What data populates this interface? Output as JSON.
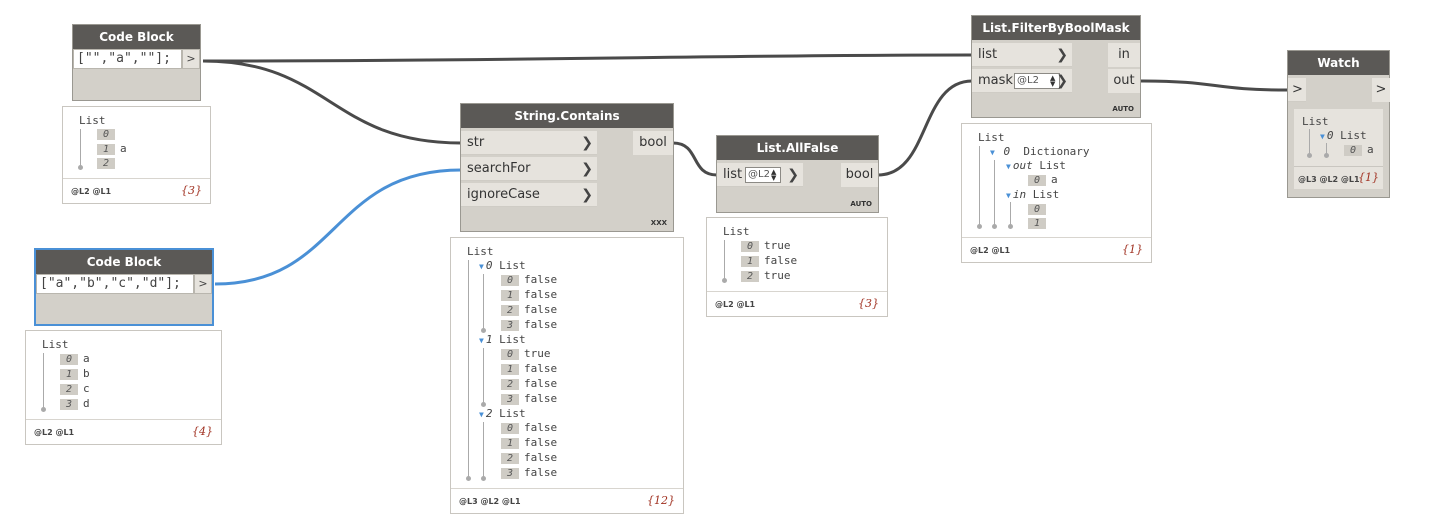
{
  "colors": {
    "node_header": "#5b5956",
    "node_body": "#d3d0c9",
    "wire": "#4a4a4a",
    "selected_wire": "#4a90d6",
    "count": "#a03020"
  },
  "code_block_1": {
    "title": "Code Block",
    "code": "[\"\",\"a\",\"\"];",
    "out": ">"
  },
  "preview_1": {
    "root": "List",
    "items": [
      {
        "idx": "0",
        "val": ""
      },
      {
        "idx": "1",
        "val": "a"
      },
      {
        "idx": "2",
        "val": ""
      }
    ],
    "levels": "@L2 @L1",
    "count": "{3}"
  },
  "code_block_2": {
    "title": "Code Block",
    "code": "[\"a\",\"b\",\"c\",\"d\"];",
    "out": ">"
  },
  "preview_2": {
    "root": "List",
    "items": [
      {
        "idx": "0",
        "val": "a"
      },
      {
        "idx": "1",
        "val": "b"
      },
      {
        "idx": "2",
        "val": "c"
      },
      {
        "idx": "3",
        "val": "d"
      }
    ],
    "levels": "@L2 @L1",
    "count": "{4}"
  },
  "string_contains": {
    "title": "String.Contains",
    "inputs": [
      "str",
      "searchFor",
      "ignoreCase"
    ],
    "output": "bool",
    "lacing": "XXX"
  },
  "preview_3": {
    "root": "List",
    "groups": [
      {
        "idx": "0",
        "label": "List",
        "items": [
          {
            "idx": "0",
            "val": "false"
          },
          {
            "idx": "1",
            "val": "false"
          },
          {
            "idx": "2",
            "val": "false"
          },
          {
            "idx": "3",
            "val": "false"
          }
        ]
      },
      {
        "idx": "1",
        "label": "List",
        "items": [
          {
            "idx": "0",
            "val": "true"
          },
          {
            "idx": "1",
            "val": "false"
          },
          {
            "idx": "2",
            "val": "false"
          },
          {
            "idx": "3",
            "val": "false"
          }
        ]
      },
      {
        "idx": "2",
        "label": "List",
        "items": [
          {
            "idx": "0",
            "val": "false"
          },
          {
            "idx": "1",
            "val": "false"
          },
          {
            "idx": "2",
            "val": "false"
          },
          {
            "idx": "3",
            "val": "false"
          }
        ]
      }
    ],
    "levels": "@L3 @L2 @L1",
    "count": "{12}"
  },
  "all_false": {
    "title": "List.AllFalse",
    "input": "list",
    "level": "@L2",
    "output": "bool",
    "lacing": "AUTO"
  },
  "preview_4": {
    "root": "List",
    "items": [
      {
        "idx": "0",
        "val": "true"
      },
      {
        "idx": "1",
        "val": "false"
      },
      {
        "idx": "2",
        "val": "true"
      }
    ],
    "levels": "@L2 @L1",
    "count": "{3}"
  },
  "filter": {
    "title": "List.FilterByBoolMask",
    "inputs": [
      "list",
      "mask"
    ],
    "mask_level": "@L2",
    "outputs": [
      "in",
      "out"
    ],
    "lacing": "AUTO"
  },
  "preview_5": {
    "root": "List",
    "dict_idx": "0",
    "dict_label": "Dictionary",
    "out_key": "out",
    "out_label": "List",
    "out_items": [
      {
        "idx": "0",
        "val": "a"
      }
    ],
    "in_key": "in",
    "in_label": "List",
    "in_items": [
      {
        "idx": "0",
        "val": ""
      },
      {
        "idx": "1",
        "val": ""
      }
    ],
    "levels": "@L2 @L1",
    "count": "{1}"
  },
  "watch": {
    "title": "Watch",
    "in": ">",
    "out": ">",
    "root": "List",
    "sub_idx": "0",
    "sub_label": "List",
    "item_idx": "0",
    "item_val": "a",
    "levels": "@L3 @L2 @L1",
    "count": "{1}"
  }
}
